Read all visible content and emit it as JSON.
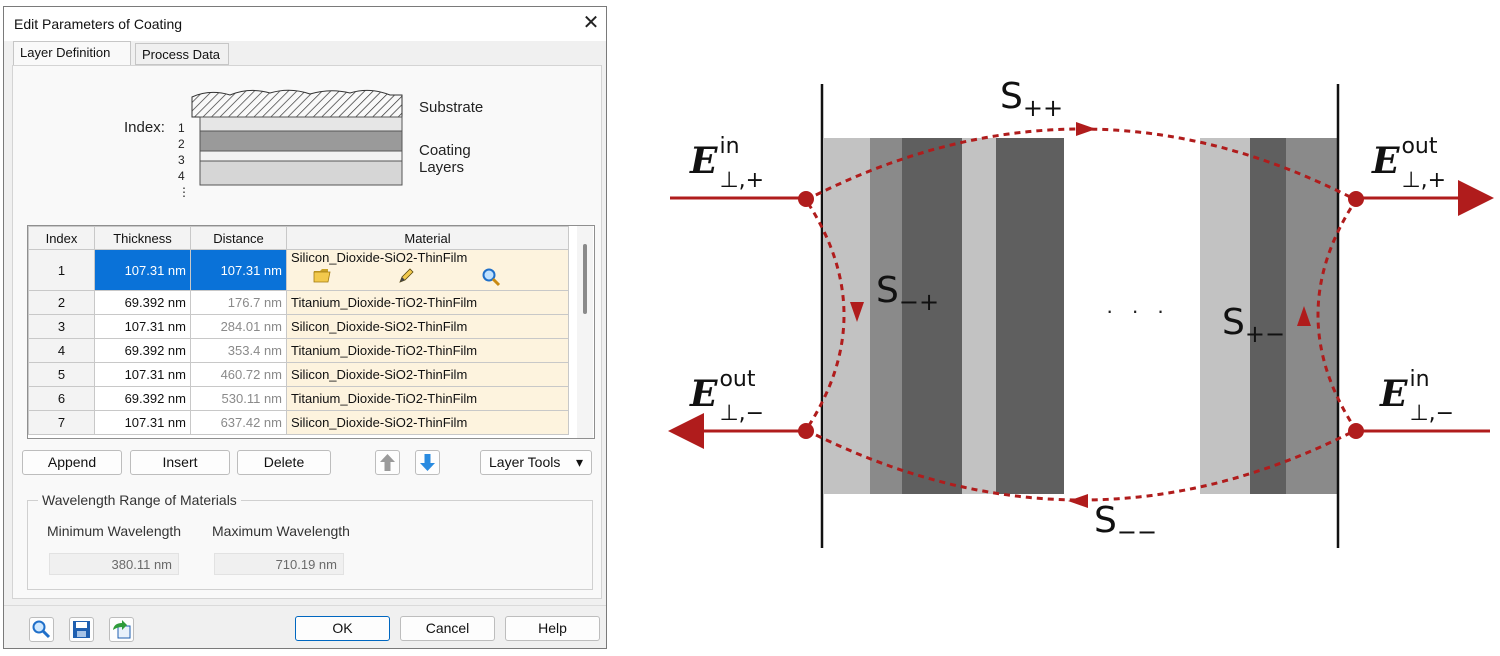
{
  "window": {
    "title": "Edit Parameters of Coating",
    "close_glyph": "✕"
  },
  "tabs": [
    {
      "label": "Layer Definition",
      "active": true
    },
    {
      "label": "Process Data",
      "active": false
    }
  ],
  "schematic": {
    "index_label": "Index:",
    "index_numbers": [
      "1",
      "2",
      "3",
      "4",
      "⋮"
    ],
    "substrate_label": "Substrate",
    "coating_label_line1": "Coating",
    "coating_label_line2": "Layers"
  },
  "table": {
    "headers": [
      "Index",
      "Thickness",
      "Distance",
      "Material"
    ],
    "rows": [
      {
        "index": "1",
        "thickness": "107.31 nm",
        "distance": "107.31 nm",
        "material": "Silicon_Dioxide-SiO2-ThinFilm",
        "selected": true
      },
      {
        "index": "2",
        "thickness": "69.392 nm",
        "distance": "176.7 nm",
        "material": "Titanium_Dioxide-TiO2-ThinFilm",
        "selected": false
      },
      {
        "index": "3",
        "thickness": "107.31 nm",
        "distance": "284.01 nm",
        "material": "Silicon_Dioxide-SiO2-ThinFilm",
        "selected": false
      },
      {
        "index": "4",
        "thickness": "69.392 nm",
        "distance": "353.4 nm",
        "material": "Titanium_Dioxide-TiO2-ThinFilm",
        "selected": false
      },
      {
        "index": "5",
        "thickness": "107.31 nm",
        "distance": "460.72 nm",
        "material": "Silicon_Dioxide-SiO2-ThinFilm",
        "selected": false
      },
      {
        "index": "6",
        "thickness": "69.392 nm",
        "distance": "530.11 nm",
        "material": "Titanium_Dioxide-TiO2-ThinFilm",
        "selected": false
      },
      {
        "index": "7",
        "thickness": "107.31 nm",
        "distance": "637.42 nm",
        "material": "Silicon_Dioxide-SiO2-ThinFilm",
        "selected": false
      }
    ],
    "selected_row_icons": [
      "open-folder-icon",
      "pencil-icon",
      "magnifier-icon"
    ]
  },
  "toolbar": {
    "append": "Append",
    "insert": "Insert",
    "delete": "Delete",
    "move_up_icon": "arrow-up-icon",
    "move_down_icon": "arrow-down-icon",
    "layer_tools": "Layer Tools",
    "layer_tools_caret": "▾"
  },
  "wavelength": {
    "group_title": "Wavelength Range of Materials",
    "min_label": "Minimum Wavelength",
    "max_label": "Maximum Wavelength",
    "min_value": "380.11 nm",
    "max_value": "710.19 nm"
  },
  "footer": {
    "icons": [
      "search-icon",
      "save-icon",
      "export-icon"
    ],
    "ok": "OK",
    "cancel": "Cancel",
    "help": "Help"
  },
  "diagram": {
    "E_symbol": "E",
    "perp": "⊥",
    "in_sup": "in",
    "out_sup": "out",
    "sub_plus": ",+",
    "sub_minus": ",−",
    "S_symbol": "S",
    "s_pp": "++",
    "s_mp": "−+",
    "s_pm": "+−",
    "s_mm": "−−",
    "dots": "· · ·",
    "colors": {
      "arrow": "#b01c1c",
      "dark": "#5f5f5f",
      "medium": "#8a8a8a",
      "light": "#c2c2c2"
    }
  }
}
